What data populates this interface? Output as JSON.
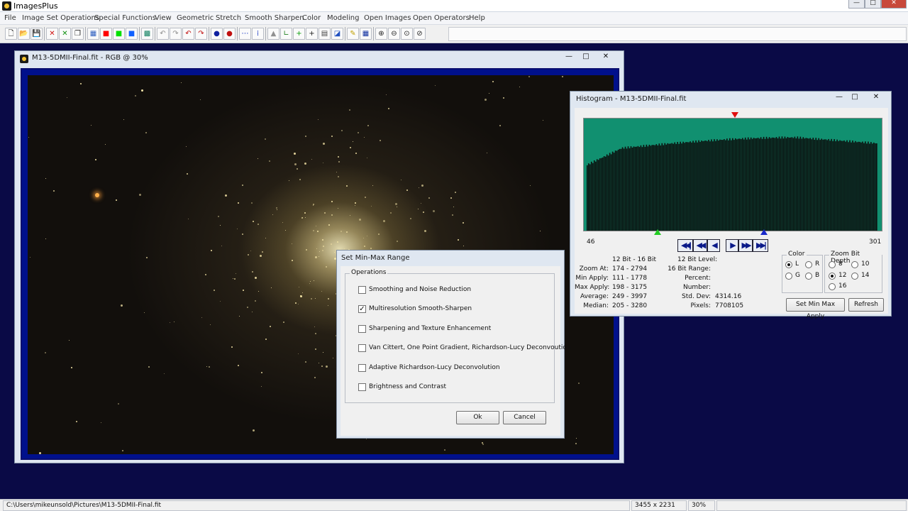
{
  "app": {
    "title": "ImagesPlus",
    "controls": {
      "minimize": "—",
      "maximize": "□",
      "close": "✕"
    }
  },
  "menu": {
    "items": [
      "File",
      "Image Set Operations",
      "Special Functions",
      "View",
      "Geometric",
      "Stretch",
      "Smooth Sharpen",
      "Color",
      "Modeling",
      "Open Images",
      "Open Operators",
      "Help"
    ]
  },
  "toolbar": {
    "buttons": [
      {
        "icon": "new-file-icon",
        "glyph": "🗋",
        "color": "#222222"
      },
      {
        "icon": "open-folder-icon",
        "glyph": "📂",
        "color": "#c89a20"
      },
      {
        "icon": "save-icon",
        "glyph": "💾",
        "color": "#222222"
      },
      {
        "icon": "close-red-icon",
        "glyph": "✕",
        "color": "#d01010"
      },
      {
        "icon": "close-green-icon",
        "glyph": "✕",
        "color": "#109010"
      },
      {
        "icon": "copy-icon",
        "glyph": "❐",
        "color": "#222222"
      },
      {
        "icon": "rgb-channels-icon",
        "glyph": "▦",
        "color": "#3060c0"
      },
      {
        "icon": "red-channel-icon",
        "glyph": "■",
        "color": "#ff0000"
      },
      {
        "icon": "green-channel-icon",
        "glyph": "■",
        "color": "#00e000"
      },
      {
        "icon": "blue-channel-icon",
        "glyph": "■",
        "color": "#1060ff"
      },
      {
        "icon": "grid-icon",
        "glyph": "▩",
        "color": "#108060"
      },
      {
        "icon": "undo-gray-icon",
        "glyph": "↶",
        "color": "#909090"
      },
      {
        "icon": "redo-gray-icon",
        "glyph": "↷",
        "color": "#909090"
      },
      {
        "icon": "undo-icon",
        "glyph": "↶",
        "color": "#c01010"
      },
      {
        "icon": "redo-icon",
        "glyph": "↷",
        "color": "#c01010"
      },
      {
        "icon": "record-blue-icon",
        "glyph": "●",
        "color": "#1020a0"
      },
      {
        "icon": "record-red-icon",
        "glyph": "●",
        "color": "#c01010"
      },
      {
        "icon": "dots-icon",
        "glyph": "⋯",
        "color": "#1030c0"
      },
      {
        "icon": "pixel-icon",
        "glyph": "⁞",
        "color": "#1030c0"
      },
      {
        "icon": "histogram-icon",
        "glyph": "▲",
        "color": "#909090"
      },
      {
        "icon": "axis-icon",
        "glyph": "∟",
        "color": "#208020"
      },
      {
        "icon": "plus-green-icon",
        "glyph": "+",
        "color": "#10a010"
      },
      {
        "icon": "crosshair-icon",
        "glyph": "+",
        "color": "#222222"
      },
      {
        "icon": "calculator-icon",
        "glyph": "▤",
        "color": "#444444"
      },
      {
        "icon": "palette-icon",
        "glyph": "◪",
        "color": "#2050c0"
      },
      {
        "icon": "pencil-icon",
        "glyph": "✎",
        "color": "#c0a000"
      },
      {
        "icon": "table-icon",
        "glyph": "▦",
        "color": "#1030a0"
      },
      {
        "icon": "zoom-in-icon",
        "glyph": "⊕",
        "color": "#222222"
      },
      {
        "icon": "zoom-out-icon",
        "glyph": "⊖",
        "color": "#222222"
      },
      {
        "icon": "zoom-fit-icon",
        "glyph": "⊙",
        "color": "#222222"
      },
      {
        "icon": "zoom-actual-icon",
        "glyph": "⊘",
        "color": "#222222"
      }
    ]
  },
  "image_window": {
    "title": "M13-5DMII-Final.fit - RGB @ 30%"
  },
  "histogram": {
    "title": "Histogram - M13-5DMII-Final.fit",
    "axis_min": "46",
    "axis_max": "301",
    "header_left": "12 Bit - 16 Bit",
    "header_right": "12 Bit Level:",
    "stats": [
      {
        "label": "Zoom At:",
        "value": "174 - 2794"
      },
      {
        "label": "Min Apply:",
        "value": "111 - 1778"
      },
      {
        "label": "Max Apply:",
        "value": "198 - 3175"
      },
      {
        "label": "Average:",
        "value": "249 - 3997"
      },
      {
        "label": "Median:",
        "value": "205 - 3280"
      }
    ],
    "stats_right": [
      {
        "label": "16 Bit Range:",
        "value": ""
      },
      {
        "label": "Percent:",
        "value": ""
      },
      {
        "label": "Number:",
        "value": ""
      },
      {
        "label": "Std. Dev:",
        "value": "4314.16"
      },
      {
        "label": "Pixels:",
        "value": "7708105"
      }
    ],
    "color_group": {
      "legend": "Color",
      "options": [
        {
          "label": "L",
          "checked": true
        },
        {
          "label": "R",
          "checked": false
        },
        {
          "label": "G",
          "checked": false
        },
        {
          "label": "B",
          "checked": false
        }
      ]
    },
    "depth_group": {
      "legend": "Zoom Bit Depth",
      "options": [
        {
          "label": "8",
          "checked": false
        },
        {
          "label": "10",
          "checked": false
        },
        {
          "label": "12",
          "checked": true
        },
        {
          "label": "14",
          "checked": false
        },
        {
          "label": "16",
          "checked": false
        }
      ]
    },
    "buttons": {
      "set_min_max": "Set Min Max Apply",
      "refresh": "Refresh"
    },
    "nav": {
      "first": "◀◀|",
      "prev_fast": "◀◀",
      "prev": "◀",
      "next": "▶",
      "next_fast": "▶▶",
      "last": "▶▶|"
    },
    "colors": {
      "fill": "#119070",
      "bars": "#0b0b0b"
    }
  },
  "minmax_dialog": {
    "title": "Set Min-Max Range",
    "group_legend": "Operations",
    "options": [
      {
        "label": "Smoothing and Noise Reduction",
        "checked": false
      },
      {
        "label": "Multiresolution Smooth-Sharpen",
        "checked": true
      },
      {
        "label": "Sharpening and Texture Enhancement",
        "checked": false
      },
      {
        "label": "Van Cittert, One Point Gradient,  Richardson-Lucy Deconvoution",
        "checked": false
      },
      {
        "label": "Adaptive Richardson-Lucy Deconvolution",
        "checked": false
      },
      {
        "label": "Brightness and Contrast",
        "checked": false
      }
    ],
    "ok_label": "Ok",
    "cancel_label": "Cancel",
    "check_glyph": "✓"
  },
  "statusbar": {
    "path": "C:\\Users\\mikeunsold\\Pictures\\M13-5DMII-Final.fit",
    "dimensions": "3455 x 2231",
    "zoom": "30%"
  }
}
